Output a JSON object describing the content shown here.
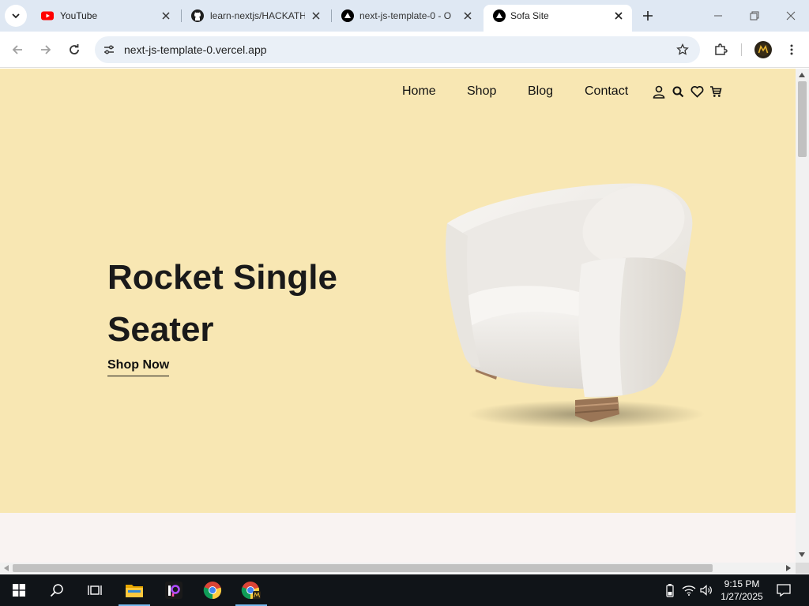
{
  "browser": {
    "tabs": [
      {
        "title": "YouTube",
        "icon": "youtube-icon"
      },
      {
        "title": "learn-nextjs/HACKATH",
        "icon": "github-icon"
      },
      {
        "title": "next-js-template-0 - O",
        "icon": "vercel-icon"
      },
      {
        "title": "Sofa Site",
        "icon": "vercel-icon",
        "active": true
      }
    ],
    "url": "next-js-template-0.vercel.app"
  },
  "page": {
    "nav": {
      "links": [
        "Home",
        "Shop",
        "Blog",
        "Contact"
      ],
      "icons": [
        "user-icon",
        "search-icon",
        "heart-icon",
        "cart-icon"
      ]
    },
    "hero": {
      "title": "Rocket Single Seater",
      "cta": "Shop Now",
      "image": "white-armchair",
      "background": "#f8e7b3"
    },
    "below_section_background": "#f9f3f2"
  },
  "taskbar": {
    "apps": [
      "windows-start-icon",
      "search-icon",
      "task-view-icon",
      "file-explorer-icon",
      "picsart-icon",
      "chrome-icon",
      "chrome-profile-icon"
    ],
    "time": "9:15 PM",
    "date": "1/27/2025"
  }
}
